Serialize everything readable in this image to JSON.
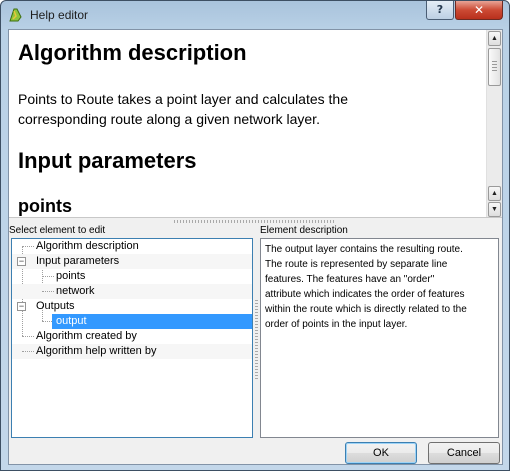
{
  "window": {
    "title": "Help editor",
    "help_label": "?",
    "close_label": "✕"
  },
  "preview": {
    "heading_algorithm": "Algorithm description",
    "paragraph": "Points to Route takes a point layer and calculates the corresponding route along a given network layer.",
    "heading_inputs": "Input parameters",
    "heading_points": "points",
    "scroll_up": "▲",
    "scroll_down": "▼"
  },
  "tree": {
    "label": "Select element to edit",
    "items": [
      {
        "label": "Algorithm description",
        "level": 0,
        "toggle": ""
      },
      {
        "label": "Input parameters",
        "level": 0,
        "toggle": "−"
      },
      {
        "label": "points",
        "level": 1,
        "toggle": ""
      },
      {
        "label": "network",
        "level": 1,
        "toggle": ""
      },
      {
        "label": "Outputs",
        "level": 0,
        "toggle": "−"
      },
      {
        "label": "output",
        "level": 1,
        "toggle": "",
        "selected": true
      },
      {
        "label": "Algorithm created by",
        "level": 0,
        "toggle": ""
      },
      {
        "label": "Algorithm help written by",
        "level": 0,
        "toggle": ""
      }
    ]
  },
  "description": {
    "label": "Element description",
    "text": "The output layer contains the resulting route.\nThe route is represented by separate line\nfeatures. The features have an \"order\"\nattribute which indicates the order of features\nwithin the route which is directly related to the\norder of points in the input layer."
  },
  "buttons": {
    "ok": "OK",
    "cancel": "Cancel"
  },
  "colors": {
    "selection": "#3399ff",
    "close_button": "#cc4a34"
  }
}
